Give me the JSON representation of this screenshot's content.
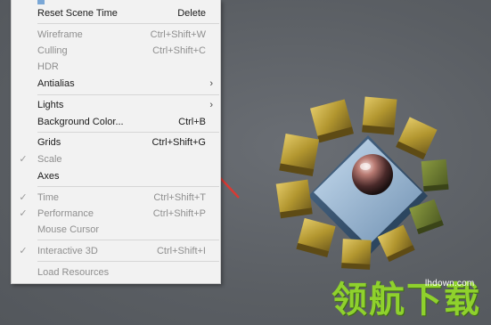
{
  "menu": {
    "items": [
      {
        "label": "Reset Scene Time",
        "shortcut": "Delete",
        "enabled": true,
        "checked": false,
        "submenu": false
      },
      {
        "label": "Wireframe",
        "shortcut": "Ctrl+Shift+W",
        "enabled": false,
        "checked": false,
        "submenu": false
      },
      {
        "label": "Culling",
        "shortcut": "Ctrl+Shift+C",
        "enabled": false,
        "checked": false,
        "submenu": false
      },
      {
        "label": "HDR",
        "shortcut": "",
        "enabled": false,
        "checked": false,
        "submenu": false
      },
      {
        "label": "Antialias",
        "shortcut": "",
        "enabled": true,
        "checked": false,
        "submenu": true
      },
      {
        "label": "Lights",
        "shortcut": "",
        "enabled": true,
        "checked": false,
        "submenu": true
      },
      {
        "label": "Background Color...",
        "shortcut": "Ctrl+B",
        "enabled": true,
        "checked": false,
        "submenu": false
      },
      {
        "label": "Grids",
        "shortcut": "Ctrl+Shift+G",
        "enabled": true,
        "checked": false,
        "submenu": false
      },
      {
        "label": "Scale",
        "shortcut": "",
        "enabled": false,
        "checked": true,
        "submenu": false
      },
      {
        "label": "Axes",
        "shortcut": "",
        "enabled": true,
        "checked": false,
        "submenu": false
      },
      {
        "label": "Time",
        "shortcut": "Ctrl+Shift+T",
        "enabled": false,
        "checked": true,
        "submenu": false
      },
      {
        "label": "Performance",
        "shortcut": "Ctrl+Shift+P",
        "enabled": false,
        "checked": true,
        "submenu": false
      },
      {
        "label": "Mouse Cursor",
        "shortcut": "",
        "enabled": false,
        "checked": false,
        "submenu": false
      },
      {
        "label": "Interactive 3D",
        "shortcut": "Ctrl+Shift+I",
        "enabled": false,
        "checked": true,
        "submenu": false
      },
      {
        "label": "Load Resources",
        "shortcut": "",
        "enabled": false,
        "checked": false,
        "submenu": false
      }
    ],
    "check_glyph": "✓",
    "submenu_glyph": "›"
  },
  "watermark": {
    "text": "领航下载",
    "url": "lhdown.com",
    "color": "#8fd12d"
  },
  "colors": {
    "viewport_bg": "#5c6066",
    "arrow": "#d83a34",
    "gold": "#b89a3a"
  }
}
